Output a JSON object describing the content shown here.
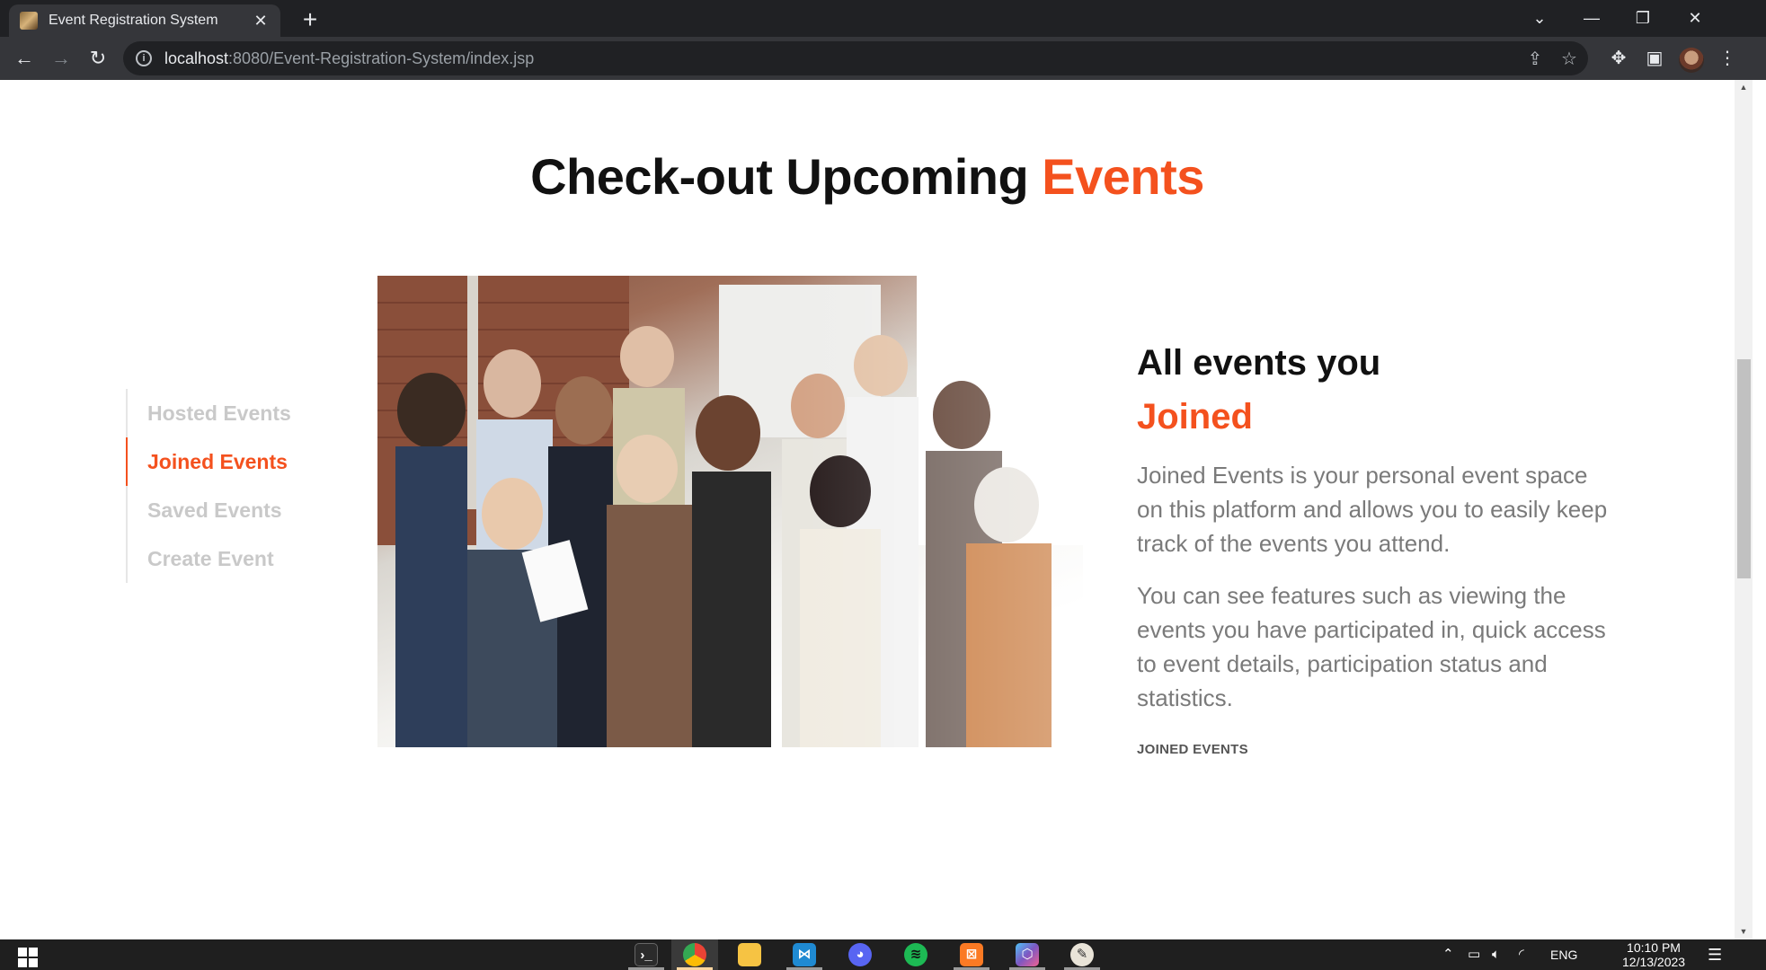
{
  "browser": {
    "tab_title": "Event Registration System",
    "tab_close": "✕",
    "new_tab": "+",
    "url_host": "localhost",
    "url_rest": ":8080/Event-Registration-System/index.jsp"
  },
  "page": {
    "heading_main": "Check-out Upcoming",
    "heading_accent": "Events",
    "side_tabs": [
      {
        "label": "Hosted Events"
      },
      {
        "label": "Joined Events"
      },
      {
        "label": "Saved Events"
      },
      {
        "label": "Create Event"
      }
    ],
    "content": {
      "title_main": "All events you",
      "title_accent": "Joined",
      "paragraph_1": "Joined Events is your personal event space on this platform and allows you to easily keep track of the events you attend.",
      "paragraph_2": "You can see features such as viewing the events you have participated in, quick access to event details, participation status and statistics.",
      "link_label": "JOINED EVENTS"
    }
  },
  "taskbar": {
    "language": "ENG",
    "time": "10:10 PM",
    "date": "12/13/2023"
  },
  "colors": {
    "accent": "#f4511e",
    "chrome_dark": "#202124",
    "chrome_toolbar": "#35363a"
  }
}
